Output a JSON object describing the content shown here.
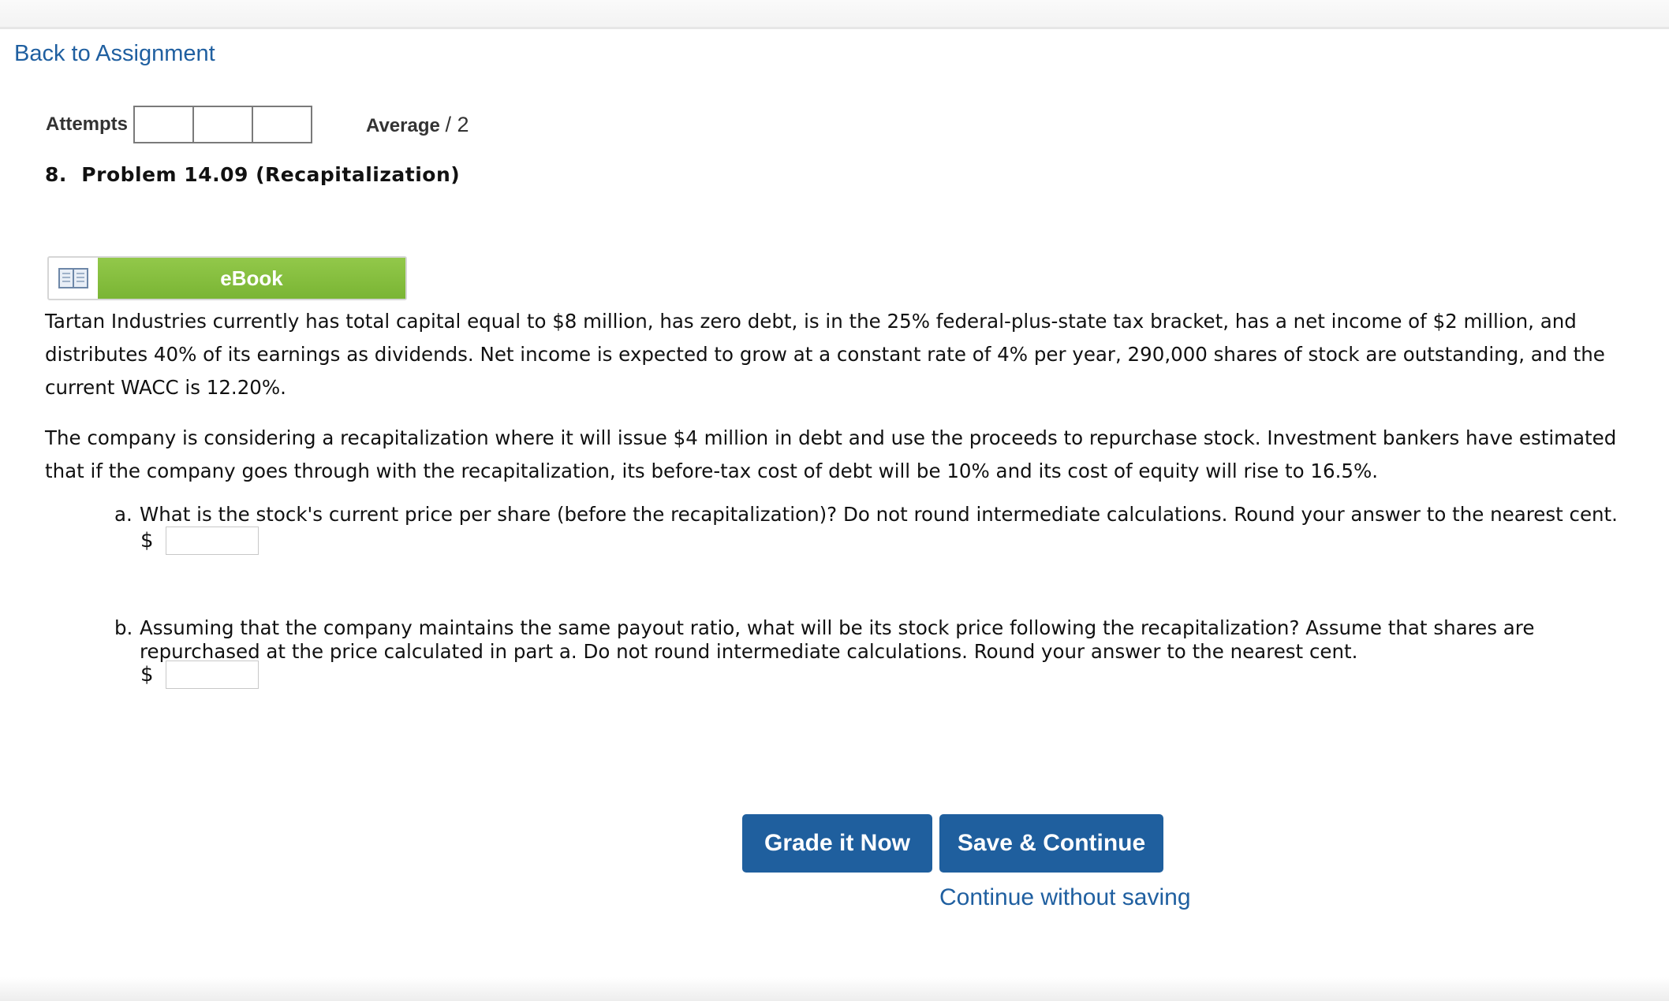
{
  "nav": {
    "back_link": "Back to Assignment"
  },
  "attempts": {
    "label": "Attempts",
    "boxes": [
      "",
      "",
      ""
    ]
  },
  "average": {
    "label": "Average",
    "value": "/ 2"
  },
  "problem": {
    "title": "8.  Problem 14.09 (Recapitalization)"
  },
  "ebook": {
    "label": "eBook",
    "icon": "book-icon"
  },
  "body": {
    "paragraph1": "Tartan Industries currently has total capital equal to $8 million, has zero debt, is in the 25% federal-plus-state tax bracket, has a net income of $2 million, and distributes 40% of its earnings as dividends. Net income is expected to grow at a constant rate of 4% per year, 290,000 shares of stock are outstanding, and the current WACC is 12.20%.",
    "paragraph2": "The company is considering a recapitalization where it will issue $4 million in debt and use the proceeds to repurchase stock. Investment bankers have estimated that if the company goes through with the recapitalization, its before-tax cost of debt will be 10% and its cost of equity will rise to 16.5%."
  },
  "questions": {
    "a": {
      "letter": "a.",
      "text": "What is the stock's current price per share (before the recapitalization)? Do not round intermediate calculations. Round your answer to the nearest cent.",
      "currency": "$",
      "value": ""
    },
    "b": {
      "letter": "b.",
      "text": "Assuming that the company maintains the same payout ratio, what will be its stock price following the recapitalization? Assume that shares are repurchased at the price calculated in part a. Do not round intermediate calculations. Round your answer to the nearest cent.",
      "currency": "$",
      "value": ""
    }
  },
  "actions": {
    "grade_label": "Grade it Now",
    "save_label": "Save & Continue",
    "continue_label": "Continue without saving"
  },
  "colors": {
    "link": "#1f5fa0",
    "button": "#1f5f9e",
    "ebook_green": "#86bf3f"
  }
}
